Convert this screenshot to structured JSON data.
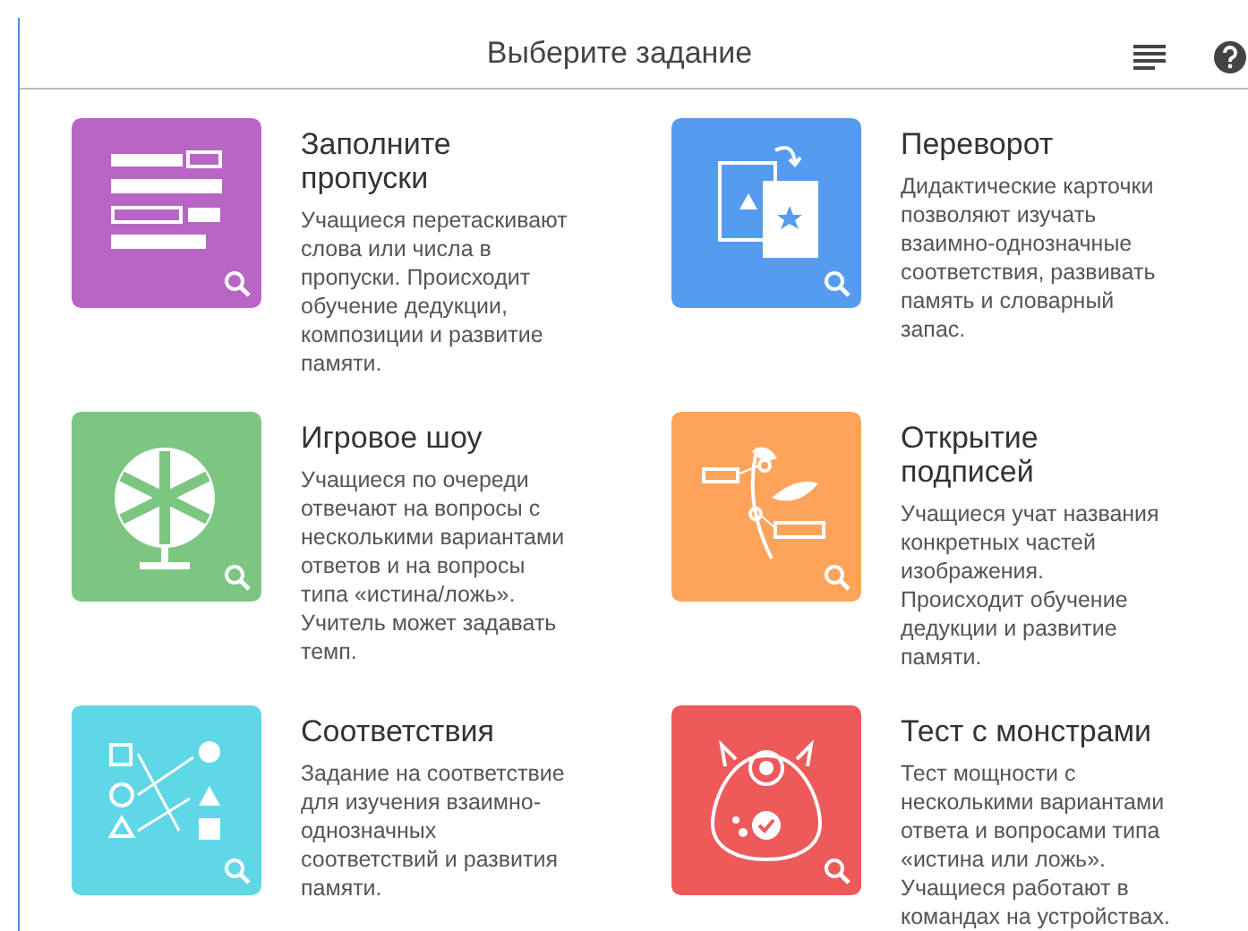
{
  "header": {
    "title": "Выберите задание"
  },
  "tasks": [
    {
      "kind": "fill-blanks",
      "color": "#b865c5",
      "title": "Заполните пропуски",
      "description": "Учащиеся перетаскивают слова или числа в пропуски. Происходит обучение дедукции, композиции и развитие памяти."
    },
    {
      "kind": "flip",
      "color": "#559cf0",
      "title": "Переворот",
      "description": "Дидактические карточки позволяют изучать взаимно-однозначные соответствия, развивать память и словарный запас."
    },
    {
      "kind": "game-show",
      "color": "#7cc682",
      "title": "Игровое шоу",
      "description": "Учащиеся по очереди отвечают на вопросы с несколькими вариантами ответов и на вопросы типа «истина/ложь». Учитель может задавать темп."
    },
    {
      "kind": "labels",
      "color": "#fda45a",
      "title": "Открытие подписей",
      "description": "Учащиеся учат названия конкретных частей изображения. Происходит обучение дедукции и развитие памяти."
    },
    {
      "kind": "matching",
      "color": "#5fd7e6",
      "title": "Соответствия",
      "description": "Задание на соответствие для изучения взаимно-однозначных соответствий и развития памяти."
    },
    {
      "kind": "monster",
      "color": "#ee5959",
      "title": "Тест с монстрами",
      "description": "Тест мощности с несколькими вариантами ответа и вопросами типа «истина или ложь». Учащиеся работают в командах на устройствах."
    }
  ]
}
